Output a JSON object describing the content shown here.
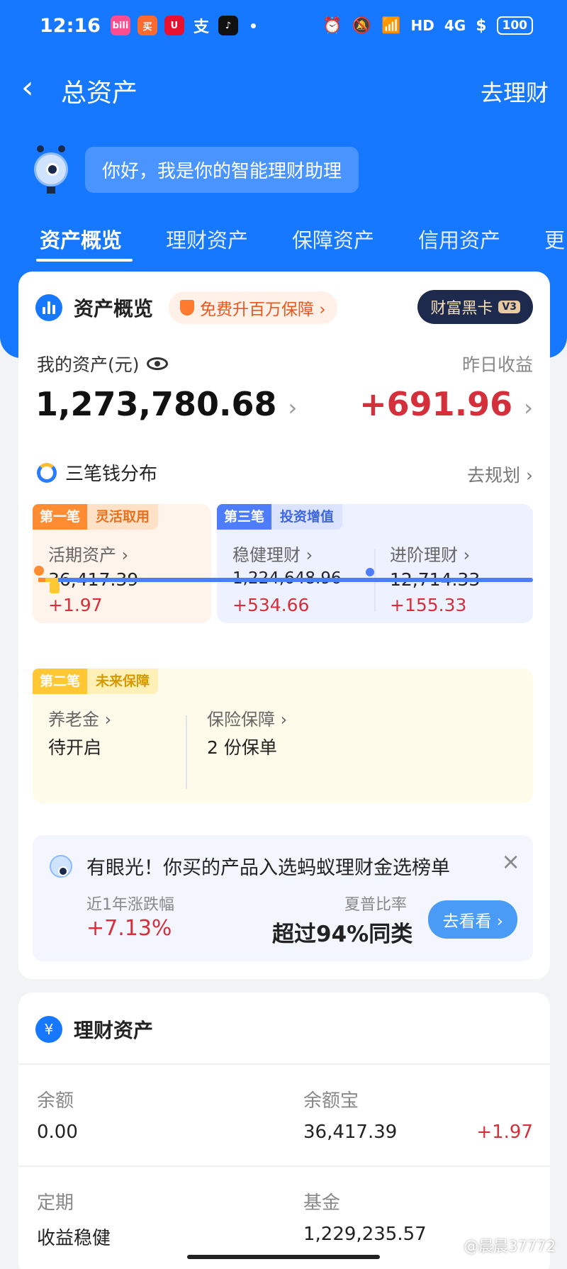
{
  "status_bar": {
    "time": "12:16",
    "app_icons": [
      {
        "name": "app-icon-1",
        "color": "#ff4d8f",
        "glyph": "bili"
      },
      {
        "name": "app-icon-2",
        "color": "#ff6a2e",
        "glyph": "买"
      },
      {
        "name": "app-icon-3",
        "color": "#e8102f",
        "glyph": "U"
      },
      {
        "name": "app-icon-4",
        "color": "#1677ff",
        "glyph": "支"
      },
      {
        "name": "tiktok-icon",
        "color": "#111111",
        "glyph": "♪"
      }
    ],
    "network": "4G",
    "hd": "HD",
    "battery": "100"
  },
  "nav": {
    "back_glyph": "‹",
    "title": "总资产",
    "right_action": "去理财"
  },
  "assistant": {
    "greeting": "你好，我是你的智能理财助理"
  },
  "tabs": [
    {
      "label": "资产概览",
      "active": true
    },
    {
      "label": "理财资产",
      "active": false
    },
    {
      "label": "保障资产",
      "active": false
    },
    {
      "label": "信用资产",
      "active": false
    },
    {
      "label": "更",
      "active": false
    }
  ],
  "overview": {
    "section_title": "资产概览",
    "promo": "免费升百万保障 ›",
    "vip_card": "财富黑卡",
    "vip_level": "V3",
    "my_assets_label": "我的资产(元)",
    "total": "1,273,780.68",
    "yesterday_label": "昨日收益",
    "yesterday_gain": "+691.96",
    "chevron": "›"
  },
  "three_money": {
    "title": "三笔钱分布",
    "plan_link": "去规划 ›",
    "first": {
      "tag": "第一笔",
      "name": "灵活取用",
      "label": "活期资产 ›",
      "value": "36,417.39",
      "gain": "+1.97"
    },
    "third": {
      "tag": "第三笔",
      "name": "投资增值",
      "items": [
        {
          "label": "稳健理财 ›",
          "value": "1,224,648.96",
          "gain": "+534.66"
        },
        {
          "label": "进阶理财 ›",
          "value": "12,714.33",
          "gain": "+155.33"
        }
      ]
    },
    "second": {
      "tag": "第二笔",
      "name": "未来保障",
      "items": [
        {
          "label": "养老金 ›",
          "value": "待开启"
        },
        {
          "label": "保险保障 ›",
          "value": "2 份保单"
        }
      ]
    }
  },
  "recommendation": {
    "title": "有眼光！你买的产品入选蚂蚁理财金选榜单",
    "close": "×",
    "metric1_label": "近1年涨跌幅",
    "metric1_value": "+7.13%",
    "metric2_label": "夏普比率",
    "metric2_value": "超过94%同类",
    "button": "去看看 ›"
  },
  "finance_assets": {
    "section_title": "理财资产",
    "icon_glyph": "¥",
    "rows": [
      [
        {
          "label": "余额",
          "value": "0.00"
        },
        {
          "label": "余额宝",
          "value": "36,417.39",
          "gain": "+1.97"
        }
      ],
      [
        {
          "label": "定期",
          "value": "收益稳健"
        },
        {
          "label": "基金",
          "value": "1,229,235.57"
        }
      ]
    ]
  },
  "watermark": "@晨晨37772",
  "colors": {
    "primary_blue": "#1677ff",
    "gain_red": "#d3303c",
    "first_orange": "#ff8c33",
    "third_blue": "#4d7dfa",
    "second_yellow": "#ffc733"
  }
}
